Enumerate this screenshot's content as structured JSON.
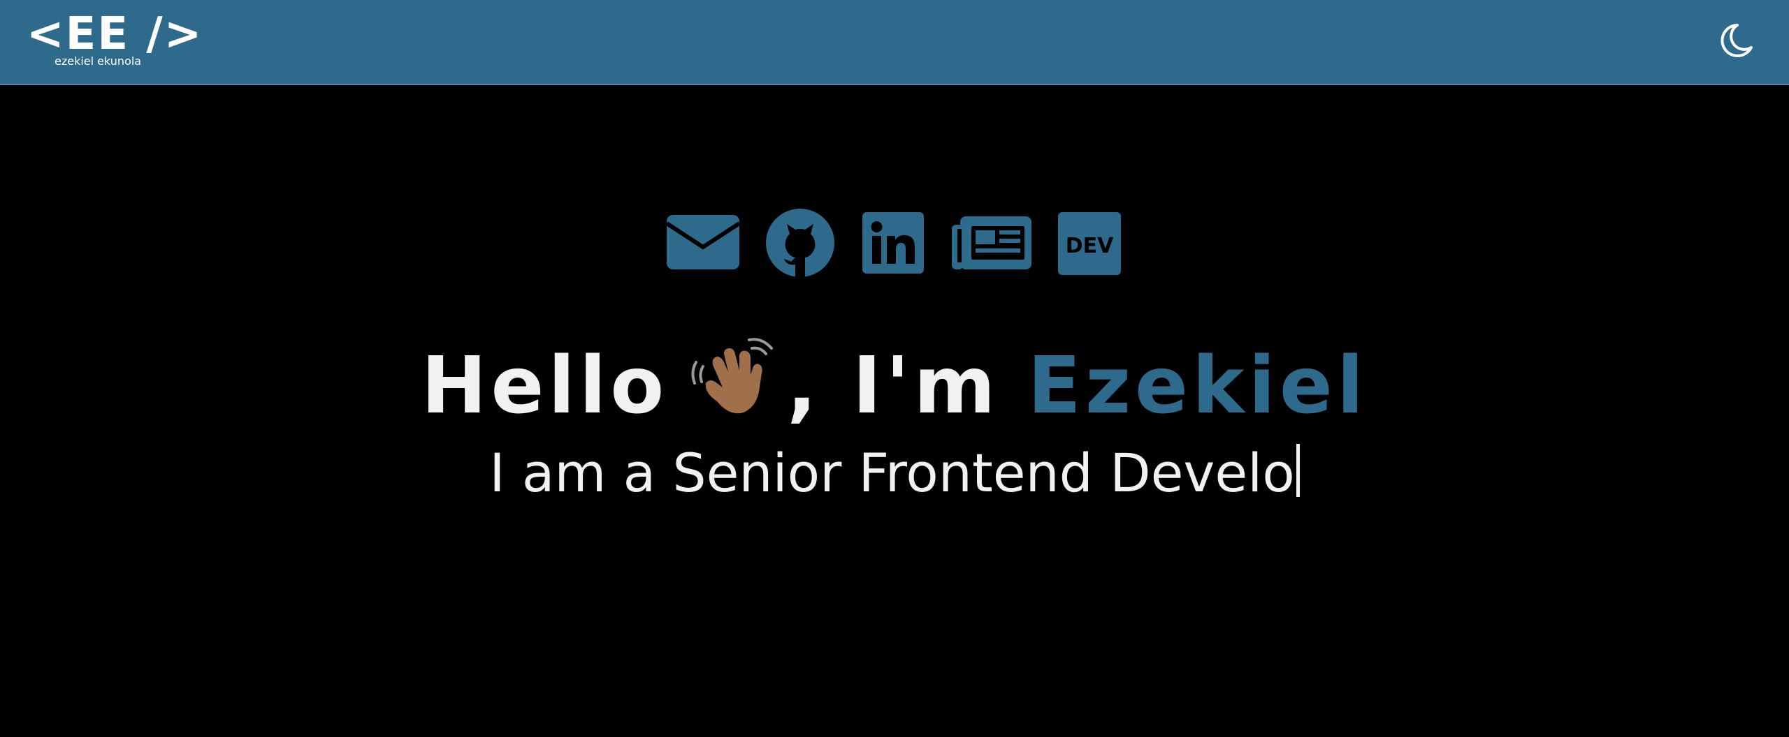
{
  "header": {
    "logo_mark": "<EE />",
    "logo_sub": "ezekiel ekunola",
    "theme_toggle_icon": "moon-icon",
    "background_color": "#2e6a8c"
  },
  "socials": [
    {
      "name": "email",
      "icon": "envelope-icon"
    },
    {
      "name": "github",
      "icon": "github-icon"
    },
    {
      "name": "linkedin",
      "icon": "linkedin-icon"
    },
    {
      "name": "blog",
      "icon": "newspaper-icon"
    },
    {
      "name": "dev",
      "icon": "dev-icon",
      "label": "DEV"
    }
  ],
  "hero": {
    "greeting": "Hello",
    "wave_icon": "waving-hand-icon",
    "intro": ", I'm",
    "name": "Ezekiel",
    "typed_text": "I am a Senior Frontend Develo",
    "accent_color": "#2e6a8c",
    "text_color": "#f1f1f3"
  }
}
